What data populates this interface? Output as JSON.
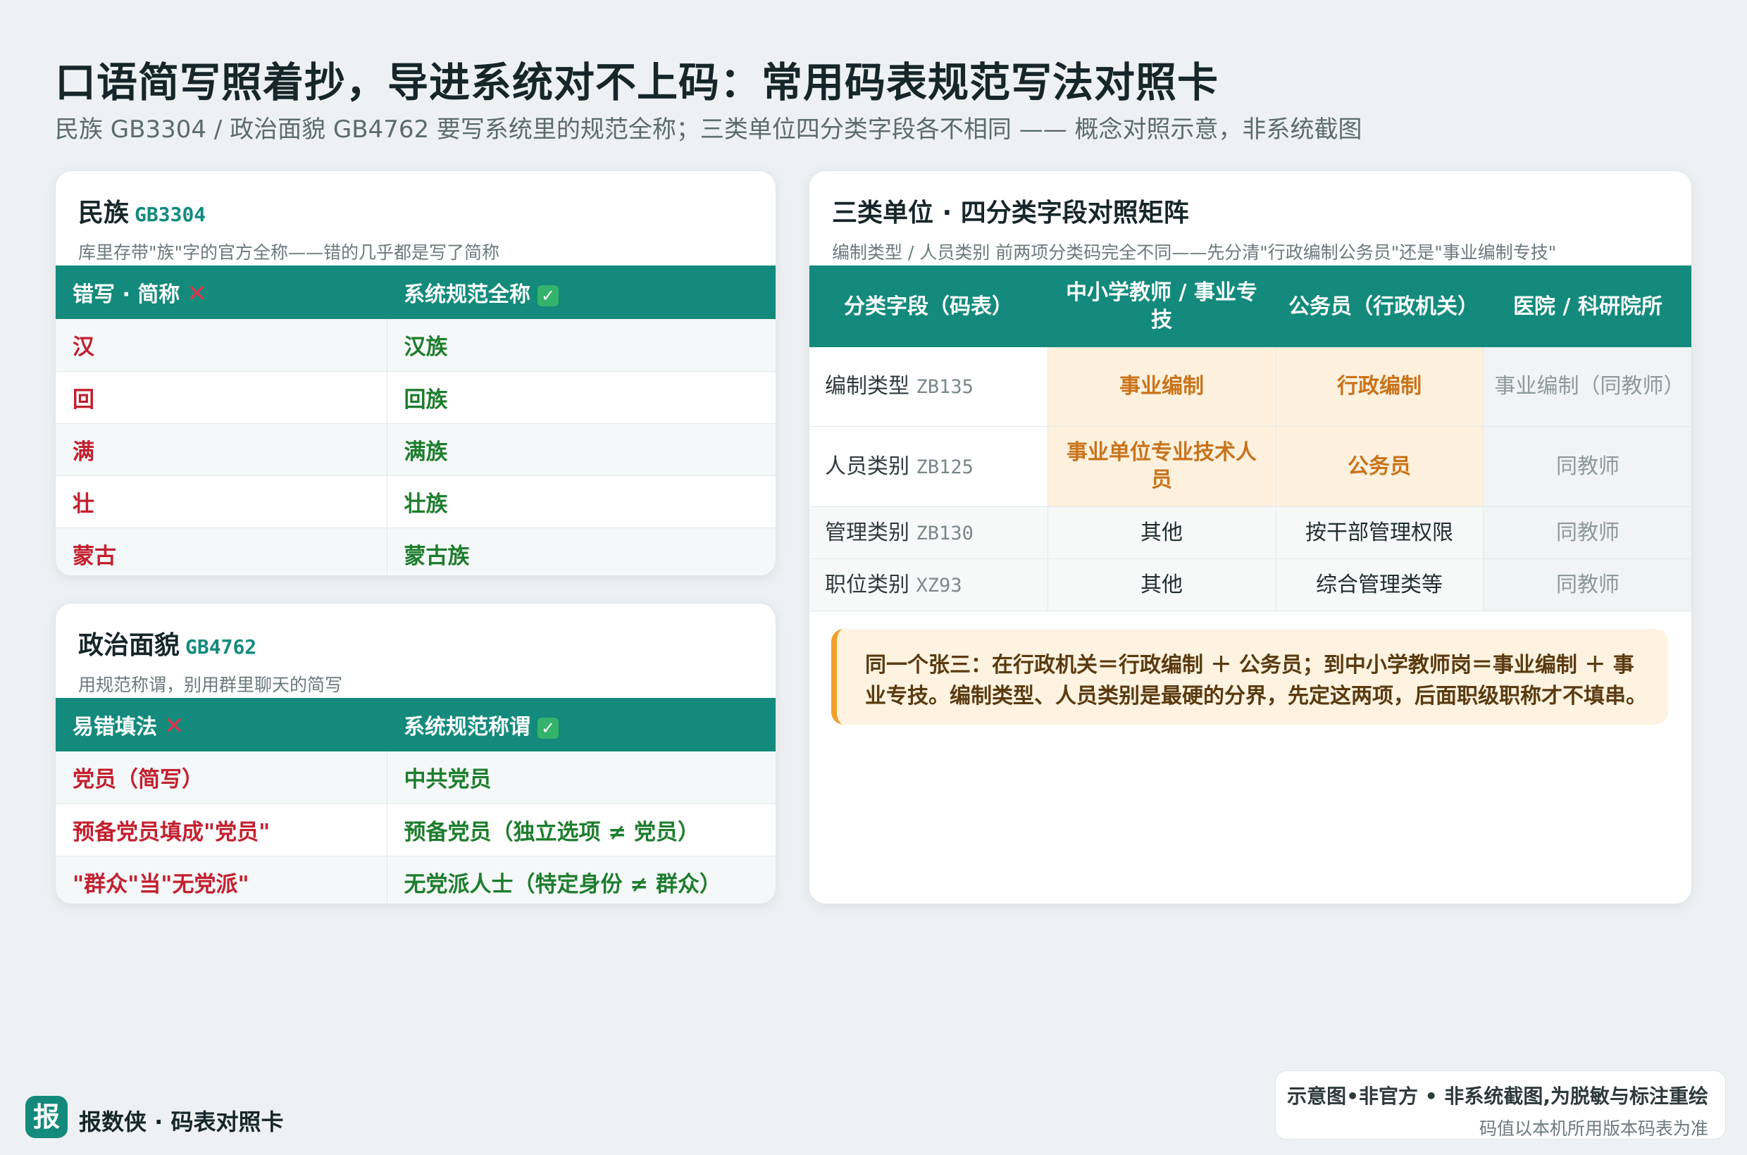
{
  "header": {
    "title": "口语简写照着抄，导进系统对不上码：常用码表规范写法对照卡",
    "subtitle": "民族 GB3304 / 政治面貌 GB4762 要写系统里的规范全称；三类单位四分类字段各不相同 —— 概念对照示意，非系统截图"
  },
  "ethnic": {
    "title": "民族",
    "code": "GB3304",
    "desc": "库里存带\"族\"字的官方全称——错的几乎都是写了简称",
    "col_wrong": "错写 · 简称",
    "col_right": "系统规范全称",
    "rows": [
      {
        "wrong": "汉",
        "right": "汉族"
      },
      {
        "wrong": "回",
        "right": "回族"
      },
      {
        "wrong": "满",
        "right": "满族"
      },
      {
        "wrong": "壮",
        "right": "壮族"
      },
      {
        "wrong": "蒙古",
        "right": "蒙古族"
      }
    ]
  },
  "political": {
    "title": "政治面貌",
    "code": "GB4762",
    "desc": "用规范称谓，别用群里聊天的简写",
    "col_wrong": "易错填法",
    "col_right": "系统规范称谓",
    "rows": [
      {
        "wrong": "党员（简写）",
        "right": "中共党员"
      },
      {
        "wrong": "预备党员填成\"党员\"",
        "right": "预备党员（独立选项 ≠ 党员）"
      },
      {
        "wrong": "\"群众\"当\"无党派\"",
        "right": "无党派人士（特定身份 ≠ 群众）"
      }
    ]
  },
  "matrix": {
    "title": "三类单位 · 四分类字段对照矩阵",
    "desc": "编制类型 / 人员类别 前两项分类码完全不同——先分清\"行政编制公务员\"还是\"事业编制专技\"",
    "headers": [
      "分类字段（码表）",
      "中小学教师 / 事业专技",
      "公务员（行政机关）",
      "医院 / 科研院所"
    ],
    "rows": [
      {
        "field": "编制类型",
        "code": "ZB135",
        "teacher": "事业编制",
        "civil": "行政编制",
        "hospital": "事业编制（同教师）"
      },
      {
        "field": "人员类别",
        "code": "ZB125",
        "teacher": "事业单位专业技术人员",
        "civil": "公务员",
        "hospital": "同教师"
      },
      {
        "field": "管理类别",
        "code": "ZB130",
        "teacher": "其他",
        "civil": "按干部管理权限",
        "hospital": "同教师"
      },
      {
        "field": "职位类别",
        "code": "XZ93",
        "teacher": "其他",
        "civil": "综合管理类等",
        "hospital": "同教师"
      }
    ],
    "note": "同一个张三：在行政机关＝行政编制 ＋ 公务员；到中小学教师岗＝事业编制 ＋ 事业专技。编制类型、人员类别是最硬的分界，先定这两项，后面职级职称才不填串。"
  },
  "footer": {
    "logo_char": "报",
    "brand": "报数侠 · 码表对照卡",
    "disclaimer_main": "示意图•非官方 • 非系统截图,为脱敏与标注重绘",
    "disclaimer_sub": "码值以本机所用版本码表为准"
  },
  "colors": {
    "accent": "#138a7c",
    "wrong": "#c3202f",
    "right": "#1d7d2d",
    "highlight_bg": "#fdf1de",
    "highlight_text": "#c9731a"
  },
  "icons": {
    "wrong": "cross-icon",
    "right": "check-icon"
  }
}
